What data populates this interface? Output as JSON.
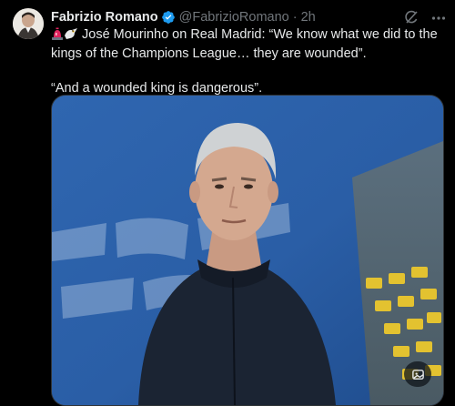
{
  "author": {
    "name": "Fabrizio Romano",
    "handle": "@FabrizioRomano",
    "separator": "·",
    "time": "2h"
  },
  "tweet": {
    "line1_rest": " José Mourinho on Real Madrid: “We know what we did to the kings of the Champions League… they are wounded”.",
    "line2": "“And a wounded king is dangerous”."
  },
  "icons": {
    "verified": "verified-badge-icon",
    "grok": "grok-icon",
    "more": "more-options-icon",
    "siren": "police-light-emoji",
    "eagle": "eagle-emoji",
    "media_action": "image-edit-icon"
  },
  "colors": {
    "background": "#000000",
    "text_primary": "#e7e9ea",
    "text_secondary": "#71767b",
    "verified_blue": "#1d9bf0"
  }
}
